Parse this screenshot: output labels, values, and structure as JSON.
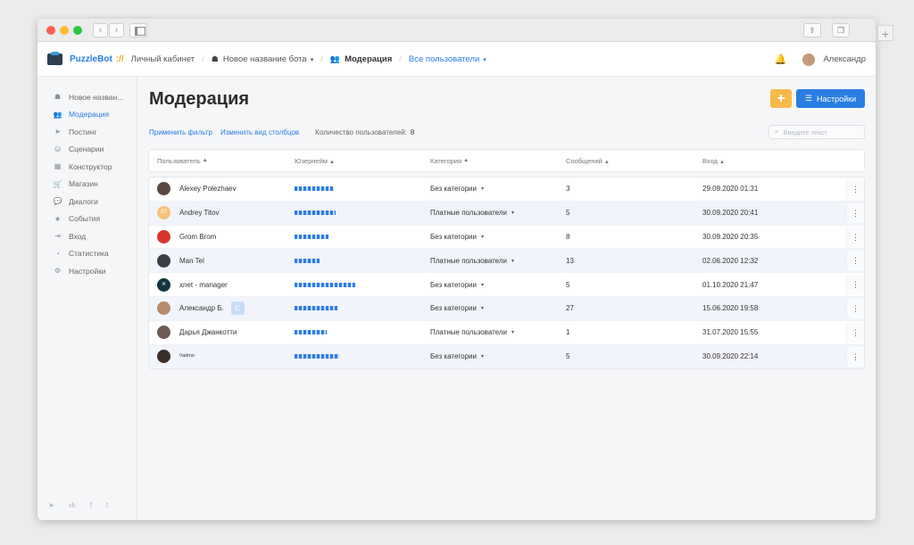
{
  "browser": {
    "back_glyph": "‹",
    "forward_glyph": "›",
    "newtab_glyph": "+",
    "share_glyph": "⇪",
    "tabs_glyph": "❐"
  },
  "topnav": {
    "logo_text": "PuzzleBot",
    "logo_slashes": "://",
    "crumb_cabinet": "Личный кабинет",
    "crumb_bot": "Новое название бота",
    "crumb_moderation": "Модерация",
    "crumb_filter": "Все пользователи",
    "separator": "/",
    "bot_glyph": "☗",
    "users_glyph": "👥",
    "caret_glyph": "▾",
    "bell_glyph": "🔔",
    "username": "Александр"
  },
  "sidebar": {
    "items": [
      {
        "label": "Новое назван...",
        "icon": "☗",
        "active": false
      },
      {
        "label": "Модерация",
        "icon": "👥",
        "active": true
      },
      {
        "label": "Постинг",
        "icon": "➤",
        "active": false
      },
      {
        "label": "Сценарии",
        "icon": "⛁",
        "active": false
      },
      {
        "label": "Конструктор",
        "icon": "▦",
        "active": false
      },
      {
        "label": "Магазин",
        "icon": "🛒",
        "active": false
      },
      {
        "label": "Диалоги",
        "icon": "💬",
        "active": false
      },
      {
        "label": "События",
        "icon": "★",
        "active": false
      },
      {
        "label": "Вход",
        "icon": "⇥",
        "active": false
      },
      {
        "label": "Статистика",
        "icon": "◔",
        "active": false
      },
      {
        "label": "Настройки",
        "icon": "⚙",
        "active": false
      }
    ],
    "social": {
      "telegram": "➤",
      "vk": "vk",
      "facebook": "f",
      "twitter": "t"
    }
  },
  "main": {
    "title": "Модерация",
    "add_glyph": "+",
    "settings_label": "Настройки",
    "settings_icon": "☰",
    "apply_filter": "Применить фильтр",
    "change_columns": "Изменить вид столбцов",
    "count_label": "Количество пользователей:",
    "count_value": "8",
    "search_placeholder": "Введите текст",
    "search_icon": "⌕",
    "sort_glyph": "▲",
    "kebab_glyph": "⋮",
    "columns": [
      "Пользователь",
      "Юзернейм",
      "Категория",
      "Сообщений",
      "Вход"
    ],
    "rows": [
      {
        "name": "Alexey Polezhaev",
        "avatar_color": "#5b4a44",
        "handle_width": 44,
        "category": "Без категории",
        "messages": "3",
        "login": "29.09.2020 01:31"
      },
      {
        "name": "Andrey Titov",
        "avatar_color": "#f6c27a",
        "avatar_text": "AT",
        "handle_width": 46,
        "category": "Платные пользователи",
        "messages": "5",
        "login": "30.09.2020 20:41"
      },
      {
        "name": "Grom Brom",
        "avatar_color": "#d8342c",
        "handle_width": 38,
        "category": "Без категории",
        "messages": "8",
        "login": "30.09.2020 20:35"
      },
      {
        "name": "Man Tel",
        "avatar_color": "#3a3f45",
        "handle_width": 28,
        "category": "Платные пользователи",
        "messages": "13",
        "login": "02.06.2020 12:32"
      },
      {
        "name": "xnet - manager",
        "avatar_color": "#11363f",
        "avatar_text": "✕",
        "handle_width": 68,
        "category": "Без категории",
        "messages": "5",
        "login": "01.10.2020 21:47"
      },
      {
        "name": "Александр Б.",
        "avatar_color": "#b88a6a",
        "badge": "C",
        "handle_width": 48,
        "category": "Без категории",
        "messages": "27",
        "login": "15.06.2020 19:58"
      },
      {
        "name": "Дарья Джанкотти",
        "avatar_color": "#6c5b55",
        "handle_width": 36,
        "category": "Платные пользователи",
        "messages": "1",
        "login": "31.07.2020 15:55"
      },
      {
        "name": "⁰ᵃᵈᵐᵒ",
        "avatar_color": "#3b2f2b",
        "handle_width": 50,
        "category": "Без категории",
        "messages": "5",
        "login": "30.09.2020 22:14"
      }
    ]
  }
}
